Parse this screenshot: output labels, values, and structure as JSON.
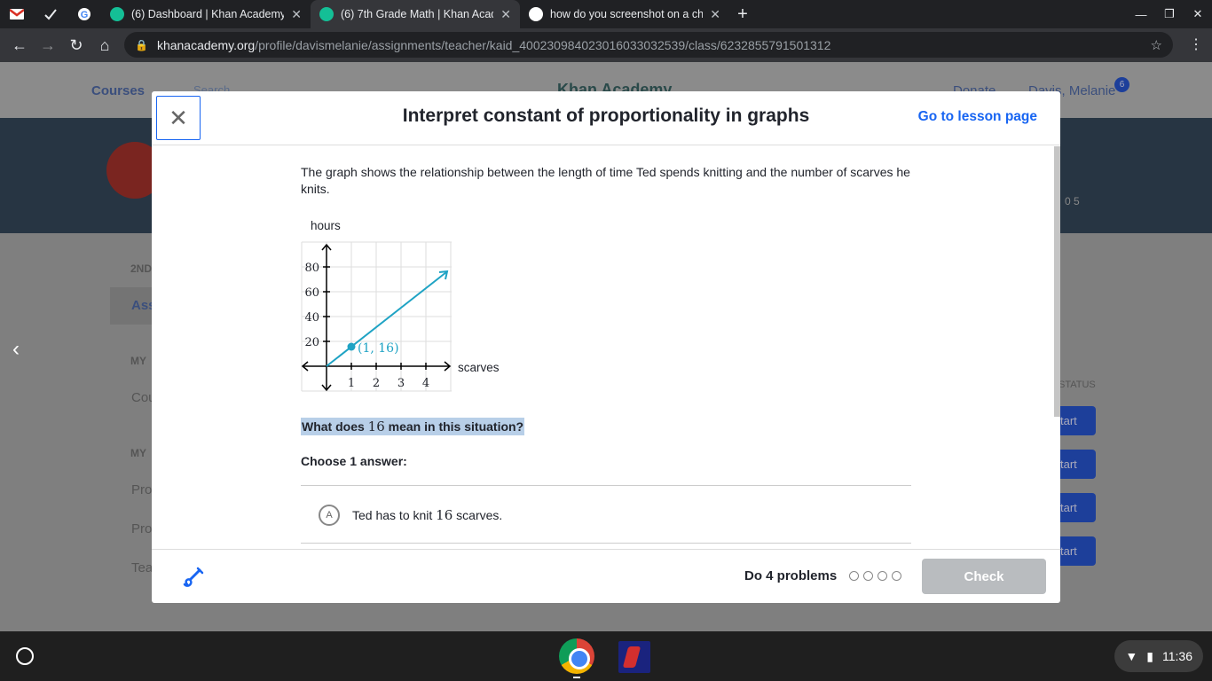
{
  "browser": {
    "tabs": [
      {
        "title": "(6) Dashboard | Khan Academy",
        "active": false
      },
      {
        "title": "(6) 7th Grade Math | Khan Acad",
        "active": true
      },
      {
        "title": "how do you screenshot on a chr",
        "active": false
      }
    ],
    "url_host": "khanacademy.org",
    "url_path": "/profile/davismelanie/assignments/teacher/kaid_400230984023016033032539/class/6232855791501312"
  },
  "background": {
    "courses": "Courses",
    "search": "Search",
    "logo": "Khan Academy",
    "donate": "Donate",
    "user": "Davis, Melanie",
    "notif_count": "6",
    "stats": "0   5",
    "sidebar": [
      "2ND",
      "Ass",
      "MY",
      "Cou",
      "MY",
      "Pro",
      "Pro",
      "Tea"
    ],
    "status_header": "STATUS",
    "start_label": "tart"
  },
  "modal": {
    "title": "Interpret constant of proportionality in graphs",
    "lesson_link": "Go to lesson page",
    "question": "The graph shows the relationship between the length of time Ted spends knitting and the number of scarves he knits.",
    "prompt_pre": "What does ",
    "prompt_num": "16",
    "prompt_post": " mean in this situation?",
    "choose": "Choose 1 answer:",
    "choice_letter": "A",
    "choice_pre": "Ted has to knit ",
    "choice_num": "16",
    "choice_post": " scarves.",
    "do_problems": "Do 4 problems",
    "check": "Check"
  },
  "graph": {
    "ylabel": "hours",
    "xlabel": "scarves",
    "yticks": [
      "80",
      "60",
      "40",
      "20"
    ],
    "xticks": [
      "1",
      "2",
      "3",
      "4"
    ],
    "point_label": "(1, 16)",
    "line_color": "#1fa3c4"
  },
  "shelf": {
    "time": "11:36"
  }
}
